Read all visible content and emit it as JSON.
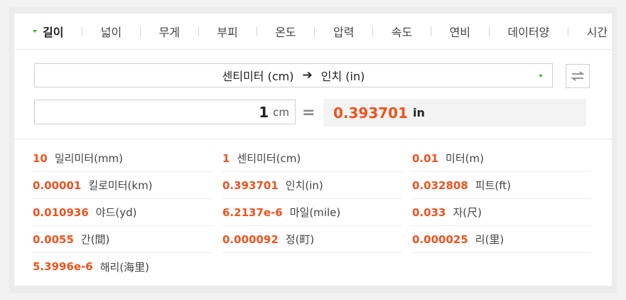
{
  "tabs": [
    {
      "label": "길이",
      "active": true
    },
    {
      "label": "넓이"
    },
    {
      "label": "무게"
    },
    {
      "label": "부피"
    },
    {
      "label": "온도"
    },
    {
      "label": "압력"
    },
    {
      "label": "속도"
    },
    {
      "label": "연비"
    },
    {
      "label": "데이터양"
    },
    {
      "label": "시간"
    }
  ],
  "converter": {
    "from_unit": "센티미터 (cm)",
    "arrow": "➔",
    "to_unit": "인치 (in)",
    "input_value": "1",
    "input_unit": "cm",
    "equals": "=",
    "result_value": "0.393701",
    "result_unit": "in"
  },
  "results": [
    [
      {
        "value": "10",
        "unit": "밀리미터(mm)"
      },
      {
        "value": "1",
        "unit": "센티미터(cm)"
      },
      {
        "value": "0.01",
        "unit": "미터(m)"
      }
    ],
    [
      {
        "value": "0.00001",
        "unit": "킬로미터(km)"
      },
      {
        "value": "0.393701",
        "unit": "인치(in)"
      },
      {
        "value": "0.032808",
        "unit": "피트(ft)"
      }
    ],
    [
      {
        "value": "0.010936",
        "unit": "야드(yd)"
      },
      {
        "value": "6.2137e-6",
        "unit": "마일(mile)"
      },
      {
        "value": "0.033",
        "unit": "자(尺)"
      }
    ],
    [
      {
        "value": "0.0055",
        "unit": "간(間)"
      },
      {
        "value": "0.000092",
        "unit": "정(町)"
      },
      {
        "value": "0.000025",
        "unit": "리(里)"
      }
    ],
    [
      {
        "value": "5.3996e-6",
        "unit": "해리(海里)"
      }
    ]
  ],
  "colors": {
    "accent_green": "#4caf3a",
    "value_orange": "#f0521e"
  }
}
